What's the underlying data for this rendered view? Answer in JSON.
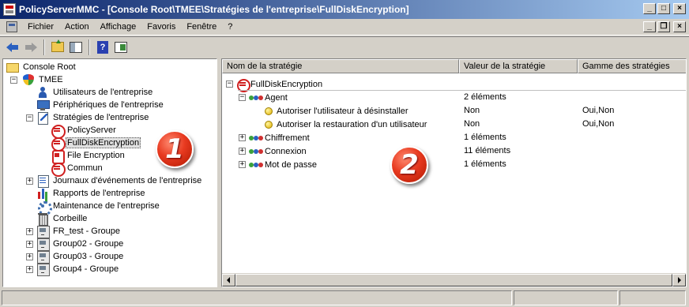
{
  "window": {
    "title": "PolicyServerMMC - [Console Root\\TMEE\\Stratégies de l'entreprise\\FullDiskEncryption]",
    "buttons": {
      "minimize": "_",
      "maximize": "□",
      "close": "×"
    }
  },
  "menu": {
    "items": [
      "Fichier",
      "Action",
      "Affichage",
      "Favoris",
      "Fenêtre",
      "?"
    ],
    "buttons": {
      "minimize": "_",
      "restore": "❐",
      "close": "×"
    }
  },
  "toolbar": {
    "help_label": "?"
  },
  "tree": {
    "items": [
      {
        "label": "Console Root",
        "icon": "folder-icon"
      },
      {
        "label": "TMEE",
        "icon": "tmee-shield-icon",
        "expander": "−"
      },
      {
        "label": "Utilisateurs de l'entreprise",
        "icon": "user-icon"
      },
      {
        "label": "Périphériques de l'entreprise",
        "icon": "monitor-icon"
      },
      {
        "label": "Stratégies de l'entreprise",
        "icon": "policy-icon",
        "expander": "−"
      },
      {
        "label": "PolicyServer",
        "icon": "policyserver-icon"
      },
      {
        "label": "FullDiskEncryption",
        "icon": "disk-encryption-icon",
        "selected": true
      },
      {
        "label": "File Encryption",
        "icon": "file-encryption-icon"
      },
      {
        "label": "Commun",
        "icon": "common-icon"
      },
      {
        "label": "Journaux d'événements de l'entreprise",
        "icon": "log-icon",
        "expander": "+"
      },
      {
        "label": "Rapports de l'entreprise",
        "icon": "report-icon"
      },
      {
        "label": "Maintenance de l'entreprise",
        "icon": "gear-icon"
      },
      {
        "label": "Corbeille",
        "icon": "recycle-bin-icon"
      },
      {
        "label": "FR_test - Groupe",
        "icon": "group-icon",
        "expander": "+"
      },
      {
        "label": "Group02 - Groupe",
        "icon": "group-icon",
        "expander": "+"
      },
      {
        "label": "Group03 - Groupe",
        "icon": "group-icon",
        "expander": "+"
      },
      {
        "label": "Group4 - Groupe",
        "icon": "group-icon",
        "expander": "+"
      }
    ]
  },
  "list": {
    "columns": [
      "Nom de la stratégie",
      "Valeur de la stratégie",
      "Gamme des stratégies"
    ],
    "rows": [
      {
        "name": "FullDiskEncryption",
        "value": "",
        "range": "",
        "expander": "−",
        "icon": "disk-encryption-icon"
      },
      {
        "name": "Agent",
        "value": "2 éléments",
        "range": "",
        "expander": "−",
        "icon": "policy-chain-icon"
      },
      {
        "name": "Autoriser l'utilisateur à désinstaller",
        "value": "Non",
        "range": "Oui,Non",
        "icon": "setting-bullet-icon"
      },
      {
        "name": "Autoriser la restauration d'un utilisateur",
        "value": "Non",
        "range": "Oui,Non",
        "icon": "setting-bullet-icon"
      },
      {
        "name": "Chiffrement",
        "value": "1 éléments",
        "range": "",
        "expander": "+",
        "icon": "policy-chain-icon"
      },
      {
        "name": "Connexion",
        "value": "11 éléments",
        "range": "",
        "expander": "+",
        "icon": "policy-chain-icon"
      },
      {
        "name": "Mot de passe",
        "value": "1 éléments",
        "range": "",
        "expander": "+",
        "icon": "policy-chain-icon"
      }
    ]
  },
  "annotations": {
    "badge1": "1",
    "badge2": "2"
  },
  "colors": {
    "titlebar_start": "#0a246a",
    "titlebar_end": "#a6caf0",
    "badge_red": "#e83a20",
    "chrome": "#d4d0c8"
  }
}
